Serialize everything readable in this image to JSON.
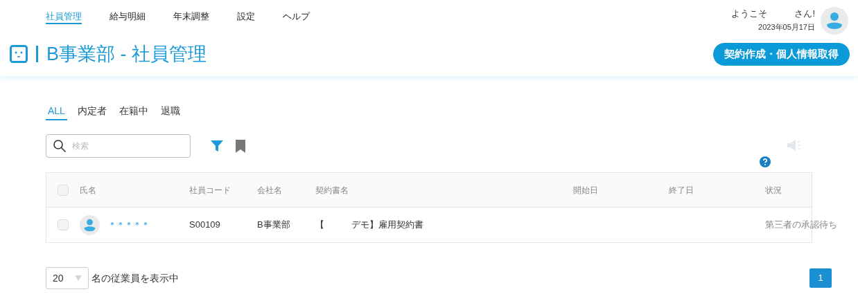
{
  "nav": [
    {
      "label": "社員管理",
      "selected": true
    },
    {
      "label": "給与明細",
      "selected": false
    },
    {
      "label": "年末調整",
      "selected": false
    },
    {
      "label": "設定",
      "selected": false
    },
    {
      "label": "ヘルプ",
      "selected": false
    }
  ],
  "user": {
    "greeting": "ようこそ　　　さん!",
    "date": "2023年05月17日"
  },
  "page_title": "B事業部 - 社員管理",
  "primary_button": "契約作成・個人情報取得",
  "tabs": [
    {
      "label": "ALL",
      "selected": true
    },
    {
      "label": "内定者",
      "selected": false
    },
    {
      "label": "在籍中",
      "selected": false
    },
    {
      "label": "退職",
      "selected": false
    }
  ],
  "search": {
    "placeholder": "検索"
  },
  "table": {
    "columns": [
      "氏名",
      "社員コード",
      "会社名",
      "契約書名",
      "開始日",
      "終了日",
      "状況"
    ],
    "select_all_checked": false,
    "rows": [
      {
        "checked": false,
        "name": "＊＊＊＊＊",
        "code": "S00109",
        "company": "B事業部",
        "contract": "【　　　デモ】雇用契約書",
        "start": "",
        "end": "",
        "status": "第三者の承認待ち"
      }
    ]
  },
  "footer": {
    "page_size": "20",
    "caption": "名の従業員を表示中",
    "pages": [
      {
        "label": "1",
        "selected": true
      }
    ]
  }
}
